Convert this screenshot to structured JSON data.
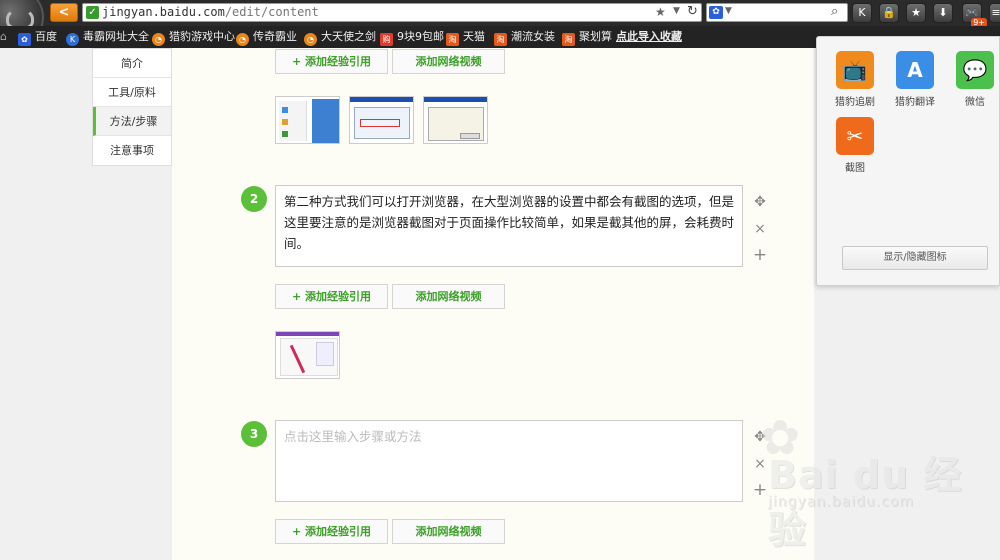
{
  "browser": {
    "url_host": "jingyan.baidu.com",
    "url_path": "/edit/content",
    "back_label": "<",
    "toolbar_badge": "9+"
  },
  "bookmarks": [
    {
      "label": "百度",
      "icon": "baidu-paw-icon",
      "color": "#2b5fd9"
    },
    {
      "label": "毒霸网址大全",
      "icon": "k-logo-icon",
      "color": "#2d6fd6"
    },
    {
      "label": "猎豹游戏中心",
      "icon": "leopard-icon",
      "color": "#e8861a"
    },
    {
      "label": "传奇霸业",
      "icon": "leopard-icon",
      "color": "#e8861a"
    },
    {
      "label": "大天使之剑",
      "icon": "leopard-icon",
      "color": "#e8861a"
    },
    {
      "label": "9块9包邮",
      "icon": "shopping-icon",
      "color": "#e03b2f"
    },
    {
      "label": "天猫",
      "icon": "tao-icon",
      "color": "#e35b1c"
    },
    {
      "label": "潮流女装",
      "icon": "tao-icon",
      "color": "#e35b1c"
    },
    {
      "label": "聚划算",
      "icon": "tao-icon",
      "color": "#e35b1c"
    },
    {
      "label": "点此导入收藏",
      "icon": "",
      "color": ""
    }
  ],
  "sidebar": {
    "items": [
      {
        "label": "简介"
      },
      {
        "label": "工具/原料"
      },
      {
        "label": "方法/步骤"
      },
      {
        "label": "注意事项"
      }
    ]
  },
  "buttons": {
    "add_reference": "+ 添加经验引用",
    "add_video": "添加网络视频"
  },
  "steps": [
    {
      "number": "2",
      "text": "第二种方式我们可以打开浏览器，在大型浏览器的设置中都会有截图的选项，但是这里要注意的是浏览器截图对于页面操作比较简单，如果是截其他的屏，会耗费时间。"
    },
    {
      "number": "3",
      "placeholder": "点击这里输入步骤或方法"
    }
  ],
  "step_controls": {
    "move_icon": "✥",
    "delete_icon": "×",
    "add_icon": "+"
  },
  "extension_panel": {
    "items": [
      {
        "label": "猎豹追剧",
        "icon": "tv-icon",
        "color": "#f08a1c"
      },
      {
        "label": "猎豹翻译",
        "icon": "translate-icon",
        "color": "#3b8ee8"
      },
      {
        "label": "微信",
        "icon": "wechat-icon",
        "color": "#4cc04c"
      },
      {
        "label": "截图",
        "icon": "scissors-icon",
        "color": "#f06a1c"
      }
    ],
    "toggle_label": "显示/隐藏图标"
  },
  "watermark": {
    "brand": "Bai du 经验",
    "url": "jingyan.baidu.com"
  }
}
